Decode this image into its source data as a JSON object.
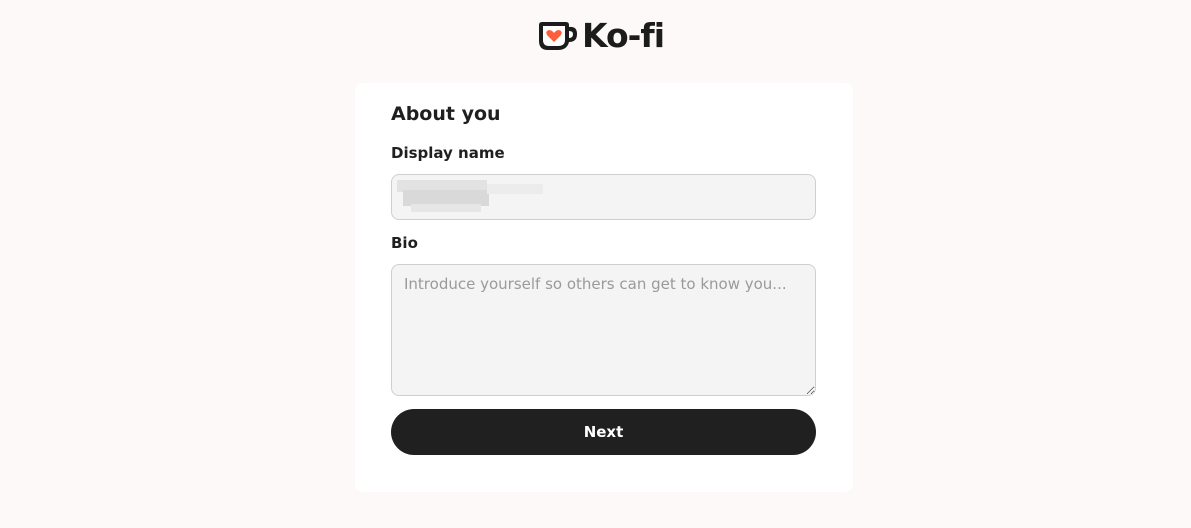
{
  "header": {
    "logo_text": "Ko-fi",
    "logo_icon": "kofi-cup-heart-icon"
  },
  "colors": {
    "page_background": "#fcf9f8",
    "card_background": "#ffffff",
    "button_background": "#202020",
    "heart": "#ff5e3a"
  },
  "form": {
    "title": "About you",
    "display_name": {
      "label": "Display name",
      "value": ""
    },
    "bio": {
      "label": "Bio",
      "placeholder": "Introduce yourself so others can get to know you...",
      "value": ""
    },
    "next_label": "Next"
  }
}
